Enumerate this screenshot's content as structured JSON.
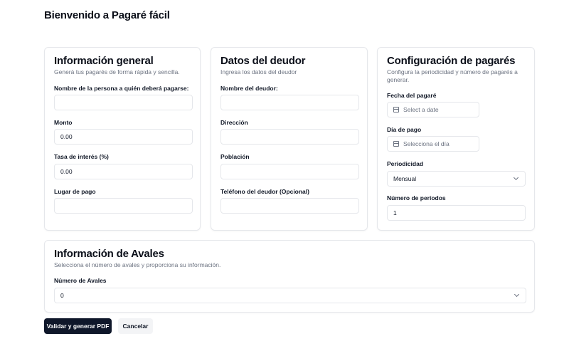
{
  "page": {
    "title": "Bienvenido a Pagaré fácil"
  },
  "general": {
    "title": "Información general",
    "description": "Generá tus pagarés de forma rápida y sencilla.",
    "payee_label": "Nombre de la persona a quién deberá pagarse:",
    "payee_value": "",
    "amount_label": "Monto",
    "amount_value": "0.00",
    "rate_label": "Tasa de interés (%)",
    "rate_value": "0.00",
    "place_label": "Lugar de pago",
    "place_value": ""
  },
  "debtor": {
    "title": "Datos del deudor",
    "description": "Ingresa los datos del deudor",
    "name_label": "Nombre del deudor:",
    "address_label": "Dirección",
    "town_label": "Población",
    "phone_label": "Teléfono del deudor (Opcional)"
  },
  "config": {
    "title": "Configuración de pagarés",
    "description": "Configura la periodicidad y número de pagarés a generar.",
    "date_label": "Fecha del pagaré",
    "date_placeholder": "Select a date",
    "payday_label": "Día de pago",
    "payday_placeholder": "Selecciona el día",
    "periodicity_label": "Periodicidad",
    "periodicity_value": "Mensual",
    "periods_label": "Número de períodos",
    "periods_value": "1"
  },
  "guarantors": {
    "title": "Información de Avales",
    "description": "Selecciona el número de avales y proporciona su información.",
    "count_label": "Número de Avales",
    "count_value": "0"
  },
  "actions": {
    "submit_label": "Validar y generar PDF",
    "cancel_label": "Cancelar"
  }
}
